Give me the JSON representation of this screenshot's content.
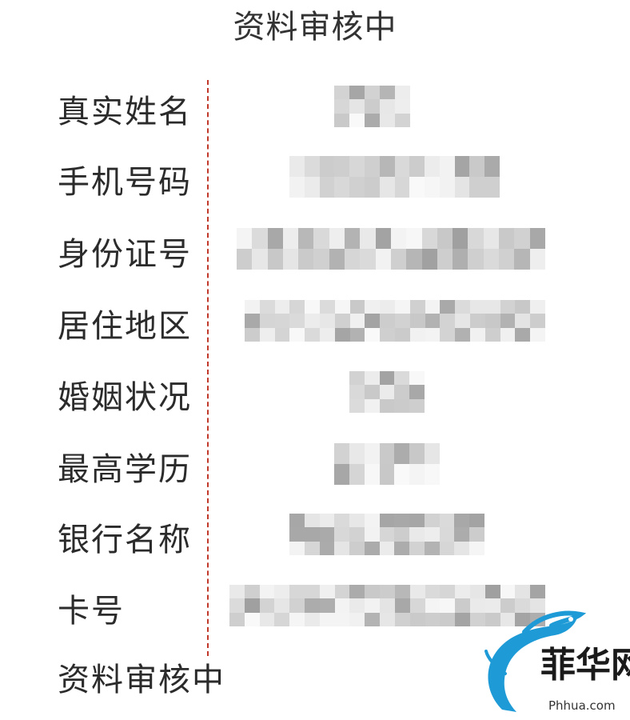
{
  "header": {
    "title": "资料审核中"
  },
  "fields": [
    {
      "label": "真实姓名",
      "value_state": "blurred"
    },
    {
      "label": "手机号码",
      "value_state": "blurred"
    },
    {
      "label": "身份证号",
      "value_state": "blurred"
    },
    {
      "label": "居住地区",
      "value_state": "blurred"
    },
    {
      "label": "婚姻状况",
      "value_state": "blurred"
    },
    {
      "label": "最高学历",
      "value_state": "blurred"
    },
    {
      "label": "银行名称",
      "value_state": "blurred"
    },
    {
      "label": "卡号",
      "value_state": "blurred"
    }
  ],
  "footer": {
    "status": "资料审核中"
  },
  "watermark": {
    "logo_text": "菲华网",
    "url": "Phhua.com"
  },
  "colors": {
    "divider": "#c0392b",
    "text": "#2b2b2b",
    "dragon_blue": "#1e9bd7"
  }
}
